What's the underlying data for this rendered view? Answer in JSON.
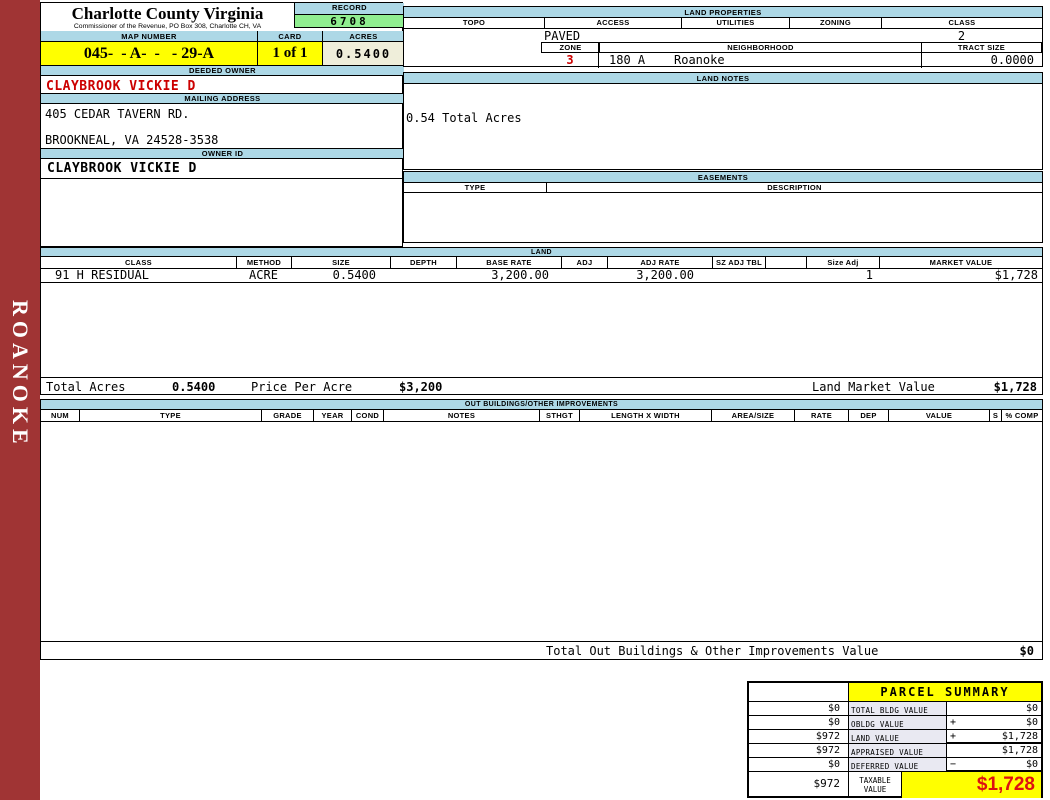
{
  "colors": {
    "sidebar_red": "#A03434",
    "header_blue": "#ADD8E6",
    "record_green": "#90EE90",
    "highlight_yellow": "#FFFF00",
    "acres_cream": "#EFEEDA",
    "alert_red": "#CC0000"
  },
  "sidebar": {
    "district": "ROANOKE"
  },
  "header": {
    "county": "Charlotte County Virginia",
    "commissioner": "Commissioner of the Revenue, PO Box 308, Charlotte CH, VA",
    "record_label": "RECORD",
    "record_value": "6708",
    "map_number_label": "MAP NUMBER",
    "map_number_value": "045-  - A-  -   - 29-A",
    "card_label": "CARD",
    "card_value": "1 of 1",
    "acres_label": "ACRES",
    "acres_value": "0.5400"
  },
  "owner": {
    "deeded_owner_label": "DEEDED OWNER",
    "deeded_owner": "CLAYBROOK VICKIE D",
    "mailing_address_label": "MAILING ADDRESS",
    "address_line1": "405 CEDAR TAVERN RD.",
    "address_line2": "BROOKNEAL, VA 24528-3538",
    "owner_id_label": "OWNER ID",
    "owner_id": "CLAYBROOK VICKIE D"
  },
  "land_properties": {
    "title": "LAND PROPERTIES",
    "topo_label": "TOPO",
    "access_label": "ACCESS",
    "access_value": "PAVED",
    "utilities_label": "UTILITIES",
    "zoning_label": "ZONING",
    "class_label": "CLASS",
    "class_value": "2",
    "zone_label": "ZONE",
    "zone_value": "3",
    "neighborhood_label": "NEIGHBORHOOD",
    "neighborhood_code": "180 A",
    "neighborhood_name": "Roanoke",
    "tract_size_label": "TRACT SIZE",
    "tract_size_value": "0.0000"
  },
  "land_notes": {
    "title": "LAND NOTES",
    "note": "0.54 Total Acres"
  },
  "easements": {
    "title": "EASEMENTS",
    "type_label": "TYPE",
    "description_label": "DESCRIPTION"
  },
  "land": {
    "title": "LAND",
    "columns": [
      "CLASS",
      "METHOD",
      "SIZE",
      "DEPTH",
      "BASE RATE",
      "ADJ",
      "ADJ RATE",
      "SZ ADJ TBL",
      "",
      "Size Adj",
      "MARKET VALUE"
    ],
    "rows": [
      {
        "class": "91 H RESIDUAL",
        "method": "ACRE",
        "size": "0.5400",
        "depth": "",
        "base_rate": "3,200.00",
        "adj": "",
        "adj_rate": "3,200.00",
        "sz_adj_tbl": "",
        "size_adj": "1",
        "market_value": "$1,728"
      }
    ],
    "total_acres_label": "Total Acres",
    "total_acres": "0.5400",
    "price_per_acre_label": "Price Per Acre",
    "price_per_acre": "$3,200",
    "land_market_value_label": "Land Market Value",
    "land_market_value": "$1,728"
  },
  "out_buildings": {
    "title": "OUT BUILDINGS/OTHER IMPROVEMENTS",
    "columns": [
      "NUM",
      "TYPE",
      "GRADE",
      "YEAR",
      "COND",
      "NOTES",
      "STHGT",
      "LENGTH X WIDTH",
      "AREA/SIZE",
      "RATE",
      "DEP",
      "VALUE",
      "S",
      "% COMP"
    ],
    "total_label": "Total Out Buildings & Other Improvements Value",
    "total_value": "$0"
  },
  "parcel_summary": {
    "title": "PARCEL SUMMARY",
    "rows": [
      {
        "prior": "$0",
        "label": "TOTAL BLDG VALUE",
        "op": "",
        "value": "$0"
      },
      {
        "prior": "$0",
        "label": "OBLDG VALUE",
        "op": "+",
        "value": "$0"
      },
      {
        "prior": "$972",
        "label": "LAND VALUE",
        "op": "+",
        "value": "$1,728"
      },
      {
        "prior": "$972",
        "label": "APPRAISED VALUE",
        "op": "",
        "value": "$1,728"
      },
      {
        "prior": "$0",
        "label": "DEFERRED VALUE",
        "op": "−",
        "value": "$0"
      }
    ],
    "taxable": {
      "prior": "$972",
      "label": "TAXABLE VALUE",
      "value": "$1,728"
    }
  }
}
